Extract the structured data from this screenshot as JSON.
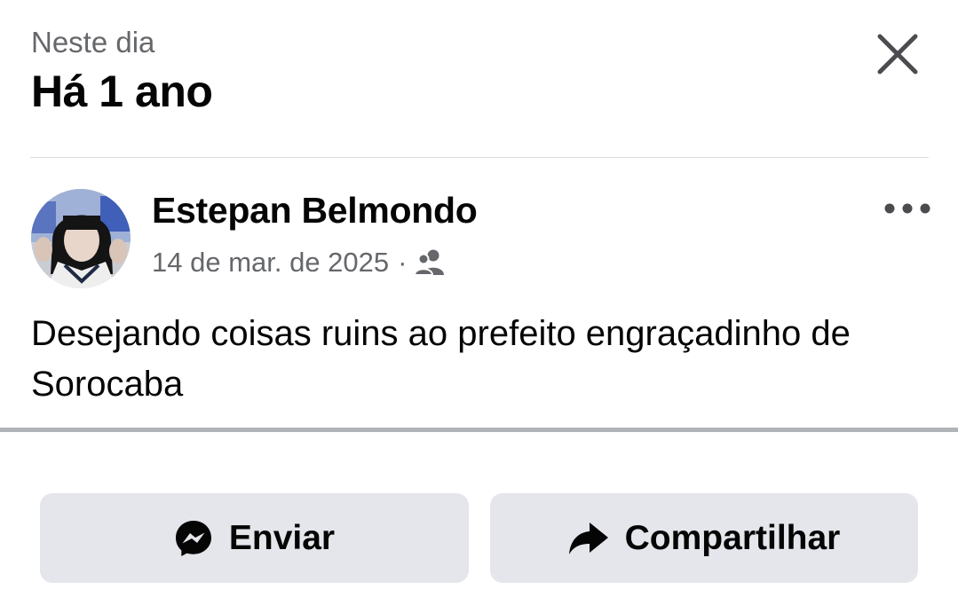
{
  "header": {
    "subtitle": "Neste dia",
    "title": "Há 1 ano",
    "close_icon": "close-icon"
  },
  "post": {
    "author": "Estepan Belmondo",
    "date": "14 de mar. de 2025",
    "separator": "·",
    "audience_icon": "friends-icon",
    "more_icon": "more-options-icon",
    "text": "Desejando coisas ruins ao prefeito engraçadinho de Sorocaba"
  },
  "actions": {
    "send_label": "Enviar",
    "send_icon": "messenger-icon",
    "share_label": "Compartilhar",
    "share_icon": "share-arrow-icon"
  },
  "colors": {
    "text_primary": "#050505",
    "text_secondary": "#65676b",
    "button_bg": "#e4e6eb",
    "divider": "#dadde1"
  }
}
